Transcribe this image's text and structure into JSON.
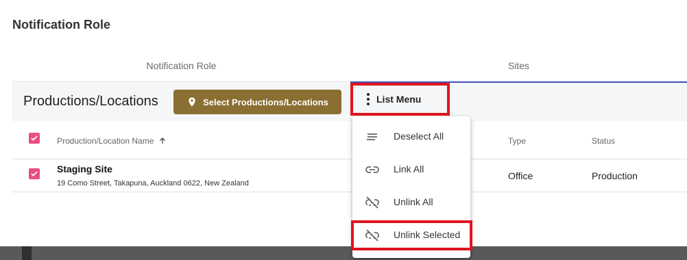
{
  "page_title": "Notification Role",
  "tabs": [
    {
      "label": "Notification Role"
    },
    {
      "label": "Sites"
    }
  ],
  "toolbar": {
    "section_title": "Productions/Locations",
    "select_button_label": "Select Productions/Locations",
    "list_menu_label": "List Menu"
  },
  "table": {
    "columns": {
      "name": "Production/Location Name",
      "type": "Type",
      "status": "Status"
    },
    "rows": [
      {
        "name": "Staging Site",
        "address": "19 Como Street, Takapuna, Auckland 0622, New Zealand",
        "type": "Office",
        "status": "Production",
        "checked": true
      }
    ]
  },
  "menu": {
    "items": [
      {
        "label": "Deselect All",
        "icon": "deselect-icon"
      },
      {
        "label": "Link All",
        "icon": "link-icon"
      },
      {
        "label": "Unlink All",
        "icon": "link-off-icon"
      },
      {
        "label": "Unlink Selected",
        "icon": "link-off-icon"
      }
    ]
  },
  "colors": {
    "primary_button": "#8a6f33",
    "tab_indicator": "#3f51b5",
    "checkbox": "#e94e84",
    "highlight": "#e0141e"
  }
}
